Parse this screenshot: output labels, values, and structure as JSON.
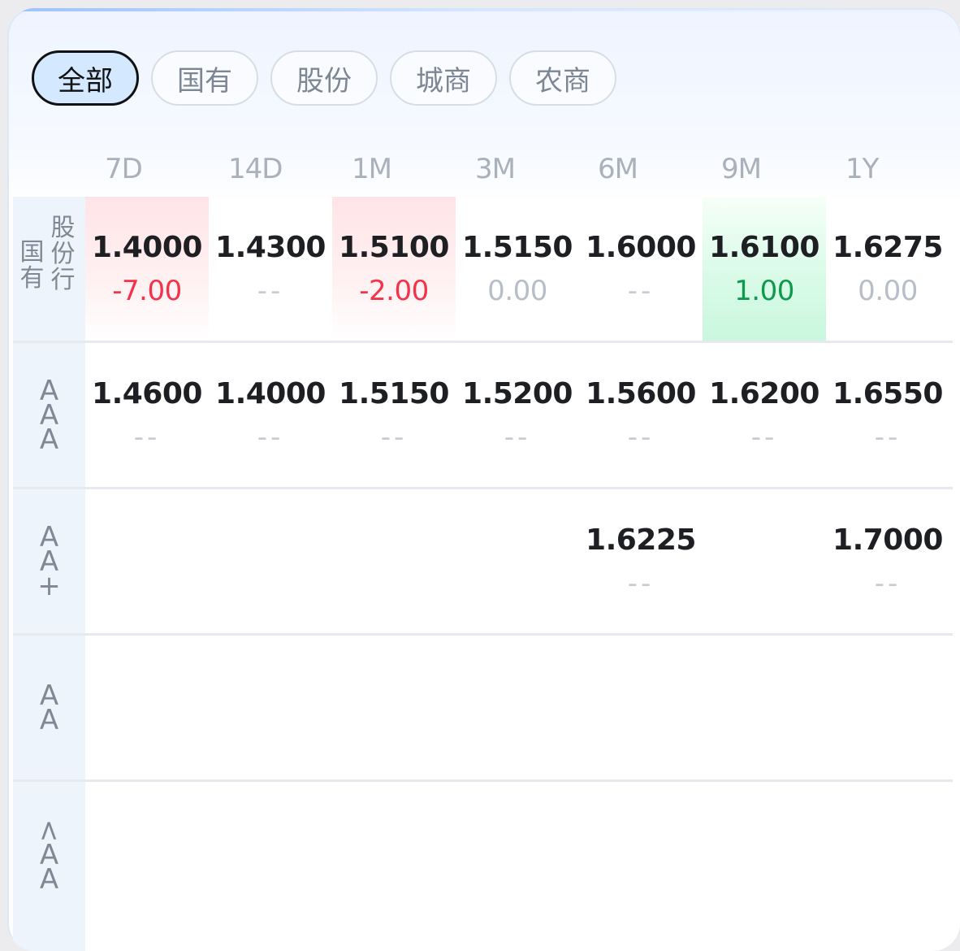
{
  "filters": [
    {
      "label": "全部",
      "active": true
    },
    {
      "label": "国有",
      "active": false
    },
    {
      "label": "股份",
      "active": false
    },
    {
      "label": "城商",
      "active": false
    },
    {
      "label": "农商",
      "active": false
    }
  ],
  "columns": [
    "7D",
    "14D",
    "1M",
    "3M",
    "6M",
    "9M",
    "1Y"
  ],
  "rows": [
    {
      "label_col1": [
        "国",
        "有"
      ],
      "label_col2": [
        "股",
        "份",
        "行"
      ],
      "cells": [
        {
          "rate": "1.4000",
          "change": "-7.00",
          "tone": "neg",
          "bg": "red"
        },
        {
          "rate": "1.4300",
          "change": "--",
          "tone": "dash",
          "bg": ""
        },
        {
          "rate": "1.5100",
          "change": "-2.00",
          "tone": "neg",
          "bg": "red"
        },
        {
          "rate": "1.5150",
          "change": "0.00",
          "tone": "zero",
          "bg": ""
        },
        {
          "rate": "1.6000",
          "change": "--",
          "tone": "dash",
          "bg": ""
        },
        {
          "rate": "1.6100",
          "change": "1.00",
          "tone": "pos",
          "bg": "green"
        },
        {
          "rate": "1.6275",
          "change": "0.00",
          "tone": "zero",
          "bg": ""
        }
      ]
    },
    {
      "label": [
        "A",
        "A",
        "A"
      ],
      "cells": [
        {
          "rate": "1.4600",
          "change": "--",
          "tone": "dash",
          "bg": ""
        },
        {
          "rate": "1.4000",
          "change": "--",
          "tone": "dash",
          "bg": ""
        },
        {
          "rate": "1.5150",
          "change": "--",
          "tone": "dash",
          "bg": ""
        },
        {
          "rate": "1.5200",
          "change": "--",
          "tone": "dash",
          "bg": ""
        },
        {
          "rate": "1.5600",
          "change": "--",
          "tone": "dash",
          "bg": ""
        },
        {
          "rate": "1.6200",
          "change": "--",
          "tone": "dash",
          "bg": ""
        },
        {
          "rate": "1.6550",
          "change": "--",
          "tone": "dash",
          "bg": ""
        }
      ]
    },
    {
      "label": [
        "A",
        "A",
        "+"
      ],
      "cells": [
        {
          "rate": "",
          "change": "",
          "tone": "",
          "bg": ""
        },
        {
          "rate": "",
          "change": "",
          "tone": "",
          "bg": ""
        },
        {
          "rate": "",
          "change": "",
          "tone": "",
          "bg": ""
        },
        {
          "rate": "",
          "change": "",
          "tone": "",
          "bg": ""
        },
        {
          "rate": "1.6225",
          "change": "--",
          "tone": "dash",
          "bg": ""
        },
        {
          "rate": "",
          "change": "",
          "tone": "",
          "bg": ""
        },
        {
          "rate": "1.7000",
          "change": "--",
          "tone": "dash",
          "bg": ""
        }
      ]
    },
    {
      "label": [
        "A",
        "A"
      ],
      "cells": []
    },
    {
      "label": [
        "<",
        "A",
        "A"
      ],
      "cells": []
    }
  ],
  "colors": {
    "negative": "#f2334a",
    "positive": "#0e9a4c",
    "neutral": "#b7bec7",
    "active_chip_bg": "#d4e8ff"
  }
}
